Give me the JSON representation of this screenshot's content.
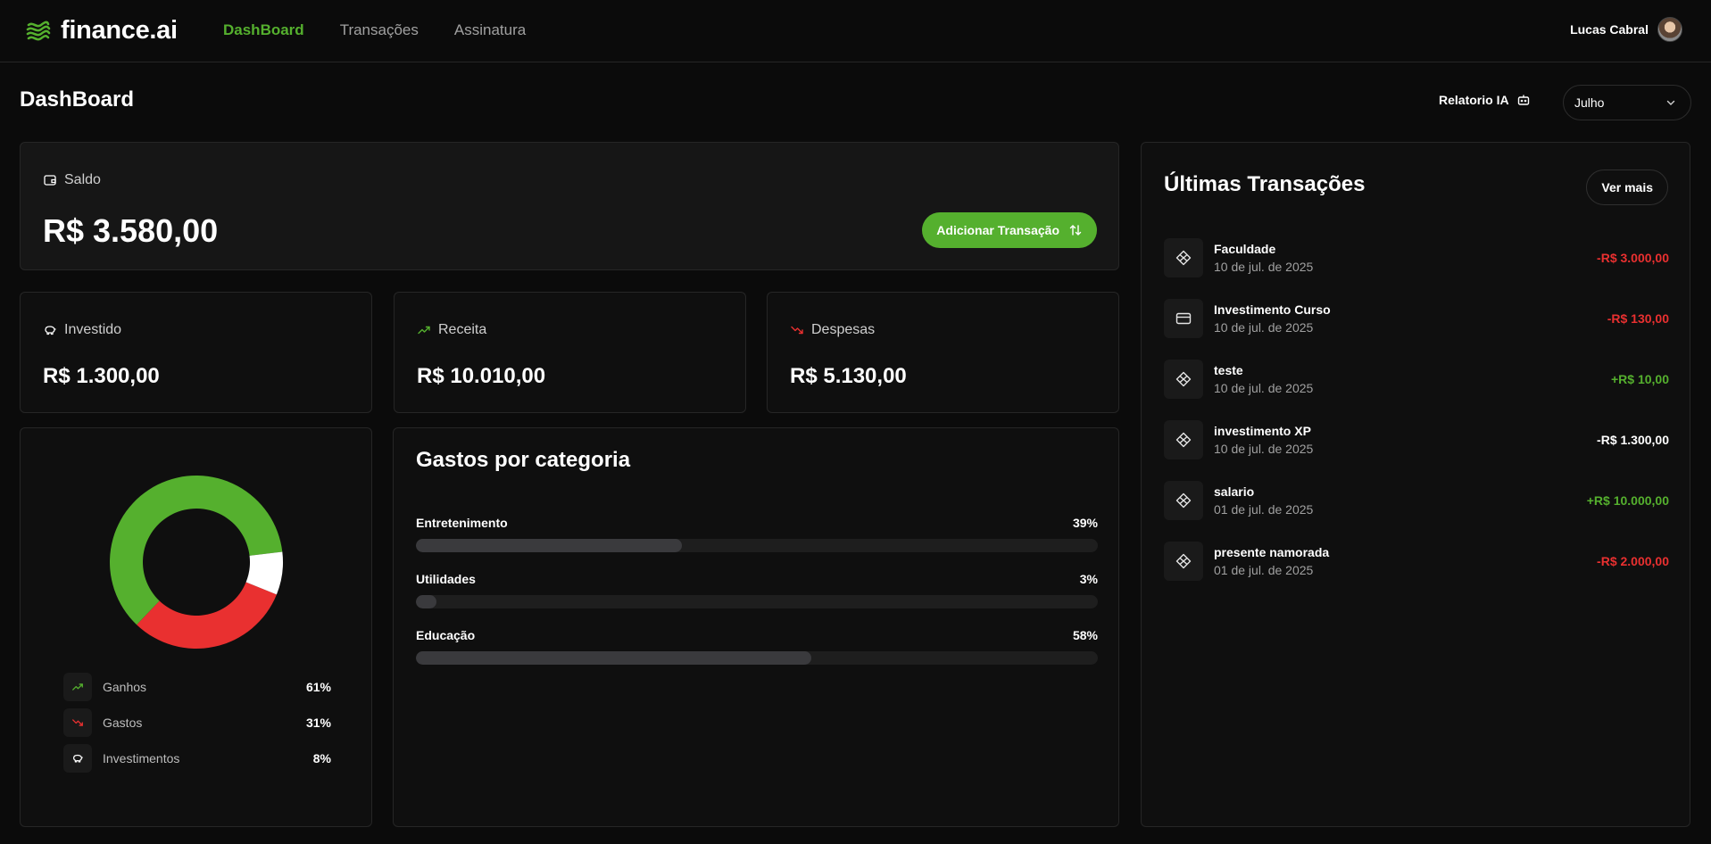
{
  "brand": {
    "name": "finance.ai",
    "accent": "#55b02e"
  },
  "nav": {
    "links": [
      "DashBoard",
      "Transações",
      "Assinatura"
    ],
    "active": "DashBoard"
  },
  "user": {
    "name": "Lucas Cabral"
  },
  "page": {
    "title": "DashBoard",
    "report_label": "Relatorio IA",
    "month": "Julho"
  },
  "saldo": {
    "label": "Saldo",
    "value": "R$ 3.580,00",
    "add_button": "Adicionar Transação"
  },
  "summary": [
    {
      "label": "Investido",
      "value": "R$ 1.300,00",
      "icon": "piggy-bank-icon",
      "icon_color": "#ffffff"
    },
    {
      "label": "Receita",
      "value": "R$ 10.010,00",
      "icon": "trending-up-icon",
      "icon_color": "#55b02e"
    },
    {
      "label": "Despesas",
      "value": "R$ 5.130,00",
      "icon": "trending-down-icon",
      "icon_color": "#e93030"
    }
  ],
  "pie": {
    "slices": [
      {
        "label": "Ganhos",
        "pct": "61%",
        "value": 61,
        "color": "#55b02e",
        "icon": "trending-up-icon"
      },
      {
        "label": "Gastos",
        "pct": "31%",
        "value": 31,
        "color": "#e93030",
        "icon": "trending-down-icon"
      },
      {
        "label": "Investimentos",
        "pct": "8%",
        "value": 8,
        "color": "#ffffff",
        "icon": "piggy-bank-icon"
      }
    ]
  },
  "categories": {
    "title": "Gastos por categoria",
    "items": [
      {
        "label": "Entretenimento",
        "pct": "39%",
        "value": 39
      },
      {
        "label": "Utilidades",
        "pct": "3%",
        "value": 3
      },
      {
        "label": "Educação",
        "pct": "58%",
        "value": 58
      }
    ]
  },
  "transactions": {
    "title": "Últimas Transações",
    "more_label": "Ver mais",
    "items": [
      {
        "name": "Faculdade",
        "date": "10 de jul. de 2025",
        "amount": "-R$ 3.000,00",
        "color": "#e93030",
        "icon": "pix-icon"
      },
      {
        "name": "Investimento Curso",
        "date": "10 de jul. de 2025",
        "amount": "-R$ 130,00",
        "color": "#e93030",
        "icon": "credit-card-icon"
      },
      {
        "name": "teste",
        "date": "10 de jul. de 2025",
        "amount": "+R$ 10,00",
        "color": "#55b02e",
        "icon": "pix-icon"
      },
      {
        "name": "investimento XP",
        "date": "10 de jul. de 2025",
        "amount": "-R$ 1.300,00",
        "color": "#ffffff",
        "icon": "pix-icon"
      },
      {
        "name": "salario",
        "date": "01 de jul. de 2025",
        "amount": "+R$ 10.000,00",
        "color": "#55b02e",
        "icon": "pix-icon"
      },
      {
        "name": "presente namorada",
        "date": "01 de jul. de 2025",
        "amount": "-R$ 2.000,00",
        "color": "#e93030",
        "icon": "pix-icon"
      }
    ]
  }
}
